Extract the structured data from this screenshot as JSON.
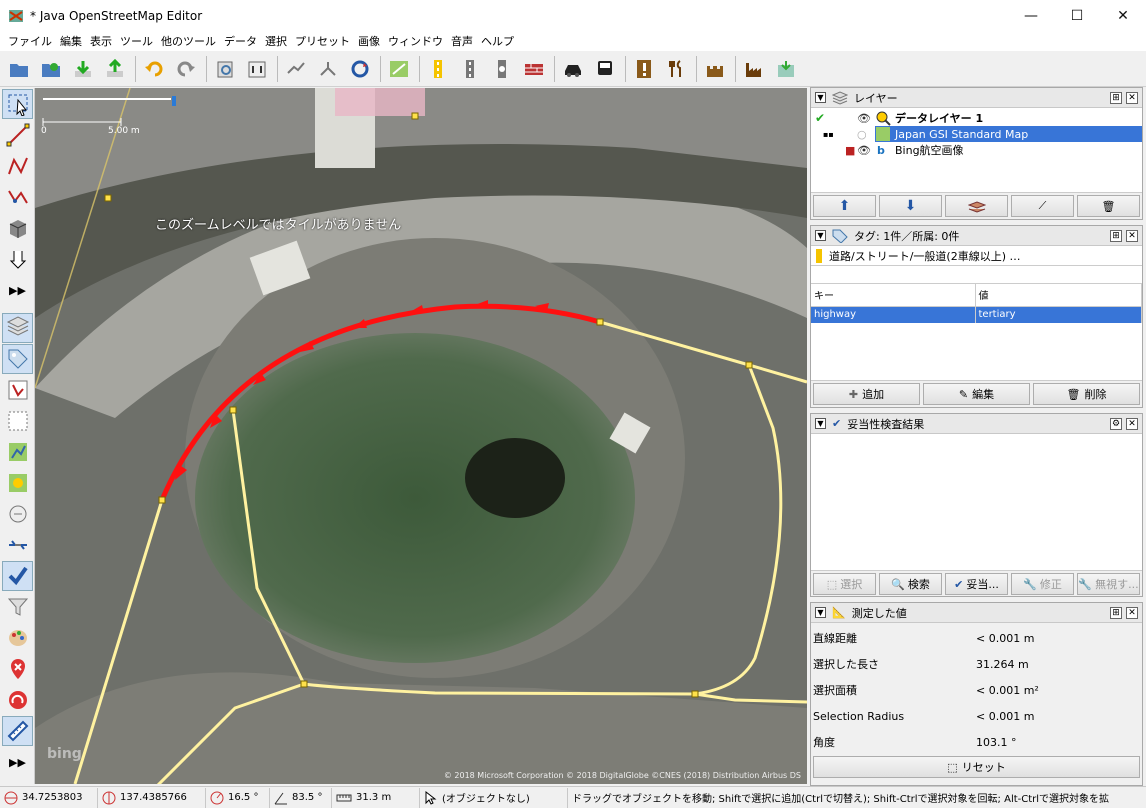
{
  "window": {
    "title": "* Java OpenStreetMap Editor"
  },
  "menu": [
    "ファイル",
    "編集",
    "表示",
    "ツール",
    "他のツール",
    "データ",
    "選択",
    "プリセット",
    "画像",
    "ウィンドウ",
    "音声",
    "ヘルプ"
  ],
  "map": {
    "no_tiles_message": "このズームレベルではタイルがありません",
    "scale_left": "0",
    "scale_right": "5.00 m",
    "copyright": "© 2018 Microsoft Corporation © 2018 DigitalGlobe ©CNES (2018) Distribution Airbus DS",
    "bing_logo": "bing"
  },
  "layers_panel": {
    "title": "レイヤー",
    "layers": [
      "データレイヤー 1",
      "Japan GSI Standard Map",
      "Bing航空画像"
    ]
  },
  "tags_panel": {
    "title": "タグ: 1件／所属: 0件",
    "preset": "道路/ストリート/一般道(2車線以上) …",
    "col_key": "キー",
    "col_value": "値",
    "rows": [
      {
        "key": "highway",
        "value": "tertiary"
      }
    ],
    "btn_add": "追加",
    "btn_edit": "編集",
    "btn_delete": "削除"
  },
  "validator_panel": {
    "title": "妥当性検査結果",
    "btn_select": "選択",
    "btn_search": "検索",
    "btn_validate": "妥当...",
    "btn_fix": "修正",
    "btn_ignore": "無視す..."
  },
  "measurement_panel": {
    "title": "測定した値",
    "rows": [
      {
        "k": "直線距離",
        "v": "< 0.001 m"
      },
      {
        "k": "選択した長さ",
        "v": "31.264 m"
      },
      {
        "k": "選択面積",
        "v": "< 0.001 m²"
      },
      {
        "k": "Selection Radius",
        "v": "< 0.001 m"
      },
      {
        "k": "角度",
        "v": "103.1 °"
      }
    ],
    "btn_reset": "リセット"
  },
  "status": {
    "lat": "34.7253803",
    "lon": "137.4385766",
    "heading": "16.5 °",
    "angle": "83.5 °",
    "length": "31.3 m",
    "object": "(オブジェクトなし)",
    "help": "ドラッグでオブジェクトを移動; Shiftで選択に追加(Ctrlで切替え); Shift-Ctrlで選択対象を回転; Alt-Ctrlで選択対象を拡"
  },
  "colors": {
    "selected_way": "#ff1010",
    "road": "#fff2a0",
    "accent": "#3875d7"
  }
}
